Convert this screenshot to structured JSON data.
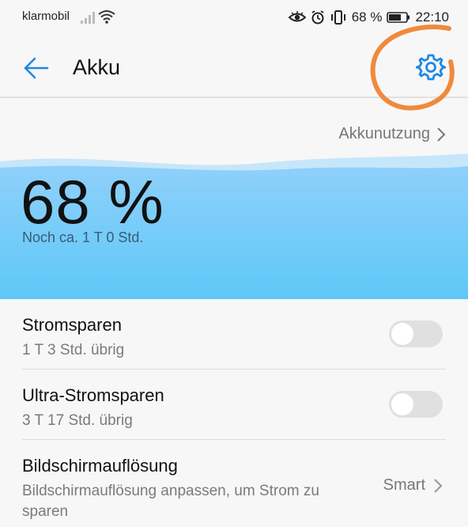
{
  "status_bar": {
    "carrier": "klarmobil",
    "battery_percent": "68 %",
    "time": "22:10",
    "icons": [
      "signal-icon",
      "wifi-icon",
      "eye-icon",
      "alarm-icon",
      "vibrate-icon",
      "battery-icon"
    ]
  },
  "toolbar": {
    "title": "Akku",
    "back_icon": "back-arrow-icon",
    "settings_icon": "gear-icon"
  },
  "usage": {
    "label": "Akkunutzung"
  },
  "battery": {
    "percent": "68 %",
    "remaining": "Noch ca. 1 T 0 Std.",
    "level": 0.68
  },
  "list": {
    "power_saving": {
      "title": "Stromsparen",
      "subtitle": "1 T 3 Std. übrig",
      "enabled": false
    },
    "ultra_power_saving": {
      "title": "Ultra-Stromsparen",
      "subtitle": "3 T 17 Std. übrig",
      "enabled": false
    },
    "resolution": {
      "title": "Bildschirmauflösung",
      "subtitle": "Bildschirmauflösung anpassen, um Strom zu sparen",
      "value": "Smart"
    }
  },
  "colors": {
    "accent": "#1e88e5",
    "annotation": "#f08a3c",
    "wave_top": "#a8d8f8",
    "wave_bottom": "#5ec8f6"
  }
}
